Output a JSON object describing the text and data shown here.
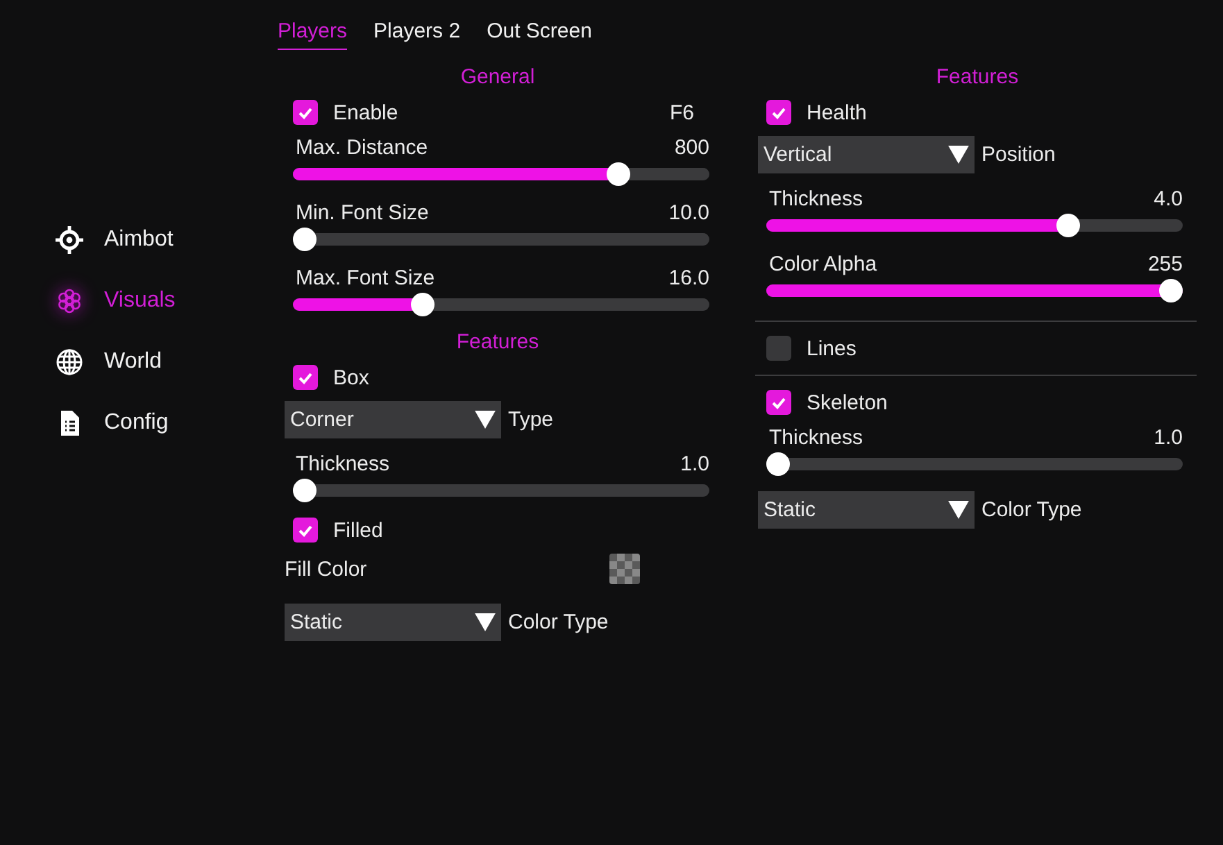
{
  "sidebar": {
    "items": [
      {
        "label": "Aimbot",
        "selected": false
      },
      {
        "label": "Visuals",
        "selected": true
      },
      {
        "label": "World",
        "selected": false
      },
      {
        "label": "Config",
        "selected": false
      }
    ]
  },
  "tabs": [
    {
      "label": "Players",
      "selected": true
    },
    {
      "label": "Players 2",
      "selected": false
    },
    {
      "label": "Out Screen",
      "selected": false
    }
  ],
  "columns": [
    {
      "rows": [
        {
          "kind": "heading",
          "label": "General"
        },
        {
          "kind": "checkbox",
          "label": "Enable",
          "checked": true,
          "hotkey": "F6"
        },
        {
          "kind": "slider",
          "label": "Max. Distance",
          "value": "800",
          "level": 0.8
        },
        {
          "kind": "slider",
          "label": "Min. Font Size",
          "value": "10.0",
          "level": 0
        },
        {
          "kind": "slider",
          "label": "Max. Font Size",
          "value": "16.0",
          "level": 0.3
        },
        {
          "kind": "heading",
          "label": "Features"
        },
        {
          "kind": "checkbox",
          "label": "Box",
          "checked": true
        },
        {
          "kind": "combo",
          "option": "Corner",
          "label": "Type"
        },
        {
          "kind": "slider",
          "label": "Thickness",
          "value": "1.0",
          "level": 0
        },
        {
          "kind": "checkbox",
          "label": "Filled",
          "checked": true
        },
        {
          "kind": "color",
          "label": "Fill Color"
        },
        {
          "kind": "combo",
          "option": "Static",
          "label": "Color Type"
        }
      ]
    },
    {
      "rows": [
        {
          "kind": "heading",
          "label": "Features"
        },
        {
          "kind": "checkbox",
          "label": "Health",
          "checked": true
        },
        {
          "kind": "combo",
          "option": "Vertical",
          "label": "Position"
        },
        {
          "kind": "slider",
          "label": "Thickness",
          "value": "4.0",
          "level": 0.74
        },
        {
          "kind": "slider",
          "label": "Color Alpha",
          "value": "255",
          "level": 1
        },
        {
          "kind": "divider"
        },
        {
          "kind": "checkbox",
          "label": "Lines",
          "checked": false
        },
        {
          "kind": "divider"
        },
        {
          "kind": "checkbox",
          "label": "Skeleton",
          "checked": true
        },
        {
          "kind": "slider",
          "label": "Thickness",
          "value": "1.0",
          "level": 0
        },
        {
          "kind": "combo",
          "option": "Static",
          "label": "Color Type"
        }
      ]
    }
  ]
}
